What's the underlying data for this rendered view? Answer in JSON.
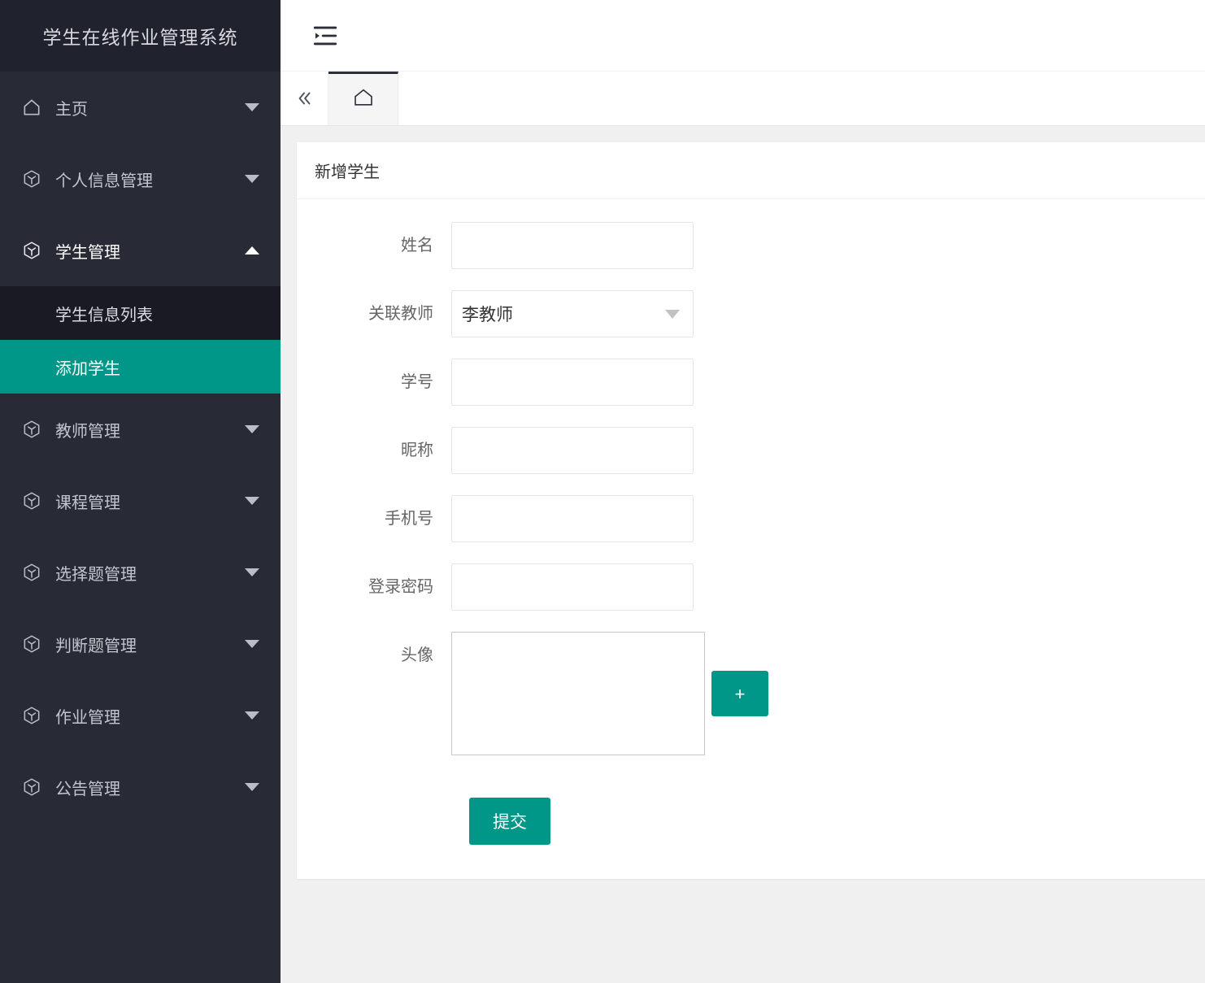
{
  "sidebar": {
    "logo_title": "学生在线作业管理系统",
    "items": [
      {
        "label": "主页",
        "icon": "home-icon",
        "arrow": "chevron-down-icon",
        "expanded": false
      },
      {
        "label": "个人信息管理",
        "icon": "cube-icon",
        "arrow": "chevron-down-icon",
        "expanded": false
      },
      {
        "label": "学生管理",
        "icon": "cube-icon",
        "arrow": "chevron-up-icon",
        "expanded": true
      },
      {
        "label": "教师管理",
        "icon": "cube-icon",
        "arrow": "chevron-down-icon",
        "expanded": false
      },
      {
        "label": "课程管理",
        "icon": "cube-icon",
        "arrow": "chevron-down-icon",
        "expanded": false
      },
      {
        "label": "选择题管理",
        "icon": "cube-icon",
        "arrow": "chevron-down-icon",
        "expanded": false
      },
      {
        "label": "判断题管理",
        "icon": "cube-icon",
        "arrow": "chevron-down-icon",
        "expanded": false
      },
      {
        "label": "作业管理",
        "icon": "cube-icon",
        "arrow": "chevron-down-icon",
        "expanded": false
      },
      {
        "label": "公告管理",
        "icon": "cube-icon",
        "arrow": "chevron-down-icon",
        "expanded": false
      }
    ],
    "submenu": [
      {
        "label": "学生信息列表",
        "active": false
      },
      {
        "label": "添加学生",
        "active": true
      }
    ]
  },
  "topbar": {
    "menu_fold_icon": "menu-fold-icon"
  },
  "tabbar": {
    "scroll_left_icon": "double-chevron-left-icon",
    "tabs": [
      {
        "icon": "home-icon",
        "label": "",
        "active": true
      }
    ]
  },
  "card": {
    "title": "新增学生",
    "fields": [
      {
        "label": "姓名",
        "type": "text",
        "value": "",
        "placeholder": ""
      },
      {
        "label": "关联教师",
        "type": "select",
        "value": "李教师",
        "options": [
          "李教师"
        ]
      },
      {
        "label": "学号",
        "type": "text",
        "value": "",
        "placeholder": ""
      },
      {
        "label": "昵称",
        "type": "text",
        "value": "",
        "placeholder": ""
      },
      {
        "label": "手机号",
        "type": "text",
        "value": "",
        "placeholder": ""
      },
      {
        "label": "登录密码",
        "type": "text",
        "value": "",
        "placeholder": ""
      },
      {
        "label": "头像",
        "type": "upload",
        "upload_button_label": "+"
      }
    ],
    "submit_label": "提交"
  },
  "colors": {
    "accent": "#009688",
    "sidebar_bg": "#282b35",
    "sidebar_logo_bg": "#20232d",
    "submenu_bg": "#191a23",
    "page_bg": "#f0f0f0",
    "tab_active_border": "#2b2f3a"
  }
}
